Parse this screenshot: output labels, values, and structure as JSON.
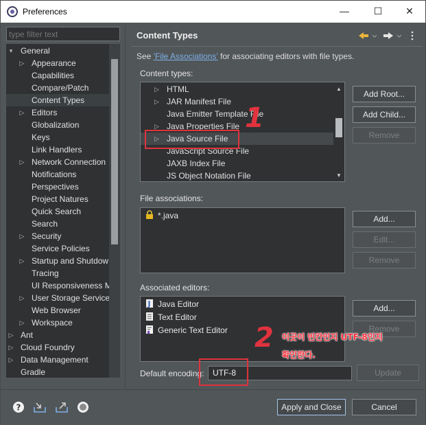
{
  "window": {
    "title": "Preferences",
    "minimize_glyph": "—",
    "maximize_glyph": "☐",
    "close_glyph": "✕"
  },
  "filter": {
    "placeholder": "type filter text"
  },
  "tree": {
    "items": [
      {
        "label": "General",
        "level": 0,
        "expanded": true,
        "hasChildren": true
      },
      {
        "label": "Appearance",
        "level": 1,
        "hasChildren": true
      },
      {
        "label": "Capabilities",
        "level": 1
      },
      {
        "label": "Compare/Patch",
        "level": 1
      },
      {
        "label": "Content Types",
        "level": 1,
        "selected": true
      },
      {
        "label": "Editors",
        "level": 1,
        "hasChildren": true
      },
      {
        "label": "Globalization",
        "level": 1
      },
      {
        "label": "Keys",
        "level": 1
      },
      {
        "label": "Link Handlers",
        "level": 1
      },
      {
        "label": "Network Connection",
        "level": 1,
        "hasChildren": true
      },
      {
        "label": "Notifications",
        "level": 1
      },
      {
        "label": "Perspectives",
        "level": 1
      },
      {
        "label": "Project Natures",
        "level": 1
      },
      {
        "label": "Quick Search",
        "level": 1
      },
      {
        "label": "Search",
        "level": 1
      },
      {
        "label": "Security",
        "level": 1,
        "hasChildren": true
      },
      {
        "label": "Service Policies",
        "level": 1
      },
      {
        "label": "Startup and Shutdow",
        "level": 1,
        "hasChildren": true
      },
      {
        "label": "Tracing",
        "level": 1
      },
      {
        "label": "UI Responsiveness M",
        "level": 1
      },
      {
        "label": "User Storage Service",
        "level": 1,
        "hasChildren": true
      },
      {
        "label": "Web Browser",
        "level": 1
      },
      {
        "label": "Workspace",
        "level": 1,
        "hasChildren": true
      },
      {
        "label": "Ant",
        "level": 0,
        "hasChildren": true
      },
      {
        "label": "Cloud Foundry",
        "level": 0,
        "hasChildren": true
      },
      {
        "label": "Data Management",
        "level": 0,
        "hasChildren": true
      },
      {
        "label": "Gradle",
        "level": 0
      }
    ]
  },
  "page": {
    "title": "Content Types",
    "see_prefix": "See ",
    "see_link": "'File Associations'",
    "see_suffix": " for associating editors with file types.",
    "content_types_label": "Content types:",
    "content_types": [
      {
        "label": "HTML",
        "hasChildren": true
      },
      {
        "label": "JAR Manifest File",
        "hasChildren": true
      },
      {
        "label": "Java Emitter Template File",
        "hasChildren": false
      },
      {
        "label": "Java Properties File",
        "hasChildren": true
      },
      {
        "label": "Java Source File",
        "hasChildren": true,
        "selected": true
      },
      {
        "label": "JavaScript Source File",
        "hasChildren": false
      },
      {
        "label": "JAXB Index File",
        "hasChildren": false
      },
      {
        "label": "JS Object Notation File",
        "hasChildren": false
      }
    ],
    "add_root": "Add Root...",
    "add_child": "Add Child...",
    "remove_ct": "Remove",
    "file_assoc_label": "File associations:",
    "file_associations": [
      {
        "label": "*.java",
        "icon": "lock-icon"
      }
    ],
    "fa_add": "Add...",
    "fa_edit": "Edit...",
    "fa_remove": "Remove",
    "assoc_editors_label": "Associated editors:",
    "editors": [
      {
        "label": "Java Editor",
        "icon": "java-editor-icon"
      },
      {
        "label": "Text Editor",
        "icon": "text-editor-icon"
      },
      {
        "label": "Generic Text Editor",
        "icon": "generic-text-editor-icon"
      }
    ],
    "ed_add": "Add...",
    "ed_remove": "Remove",
    "encoding_label": "Default encoding:",
    "encoding_value": "UTF-8",
    "update": "Update"
  },
  "annotations": {
    "num1": "1",
    "num2": "2",
    "note_line1": "이곳이 빈칸인지 UTF-8인지",
    "note_line2": "확인한다.",
    "color": "#e0333e"
  },
  "footer": {
    "apply_close": "Apply and Close",
    "cancel": "Cancel"
  }
}
